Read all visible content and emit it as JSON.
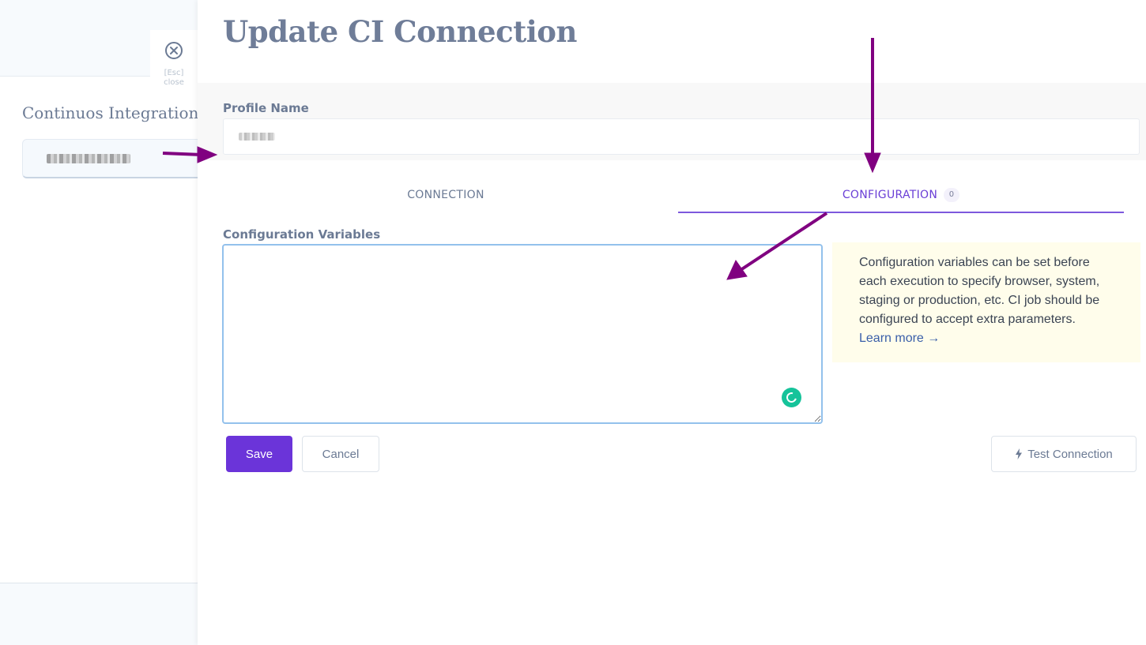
{
  "background": {
    "heading": "Continuos Integration",
    "close_hint": "[Esc]\nclose"
  },
  "drawer": {
    "title": "Update CI Connection",
    "profile": {
      "label": "Profile Name",
      "value": ""
    },
    "tabs": [
      {
        "label": "CONNECTION"
      },
      {
        "label": "CONFIGURATION",
        "badge": "0",
        "active": true
      }
    ],
    "config": {
      "label": "Configuration Variables",
      "value": ""
    },
    "info": {
      "text": "Configuration variables can be set before each execution to specify browser, system, staging or production, etc. CI job should be configured to accept extra parameters.",
      "link": "Learn more →"
    },
    "buttons": {
      "save": "Save",
      "cancel": "Cancel",
      "test": "Test Connection"
    }
  },
  "colors": {
    "accent": "#6b34d9",
    "annotation_arrow": "#800080",
    "info_bg": "#fffdeb"
  },
  "icons": {
    "close": "close-circle-icon",
    "test": "lightning-bolt-icon",
    "grammarly": "grammarly-icon"
  }
}
